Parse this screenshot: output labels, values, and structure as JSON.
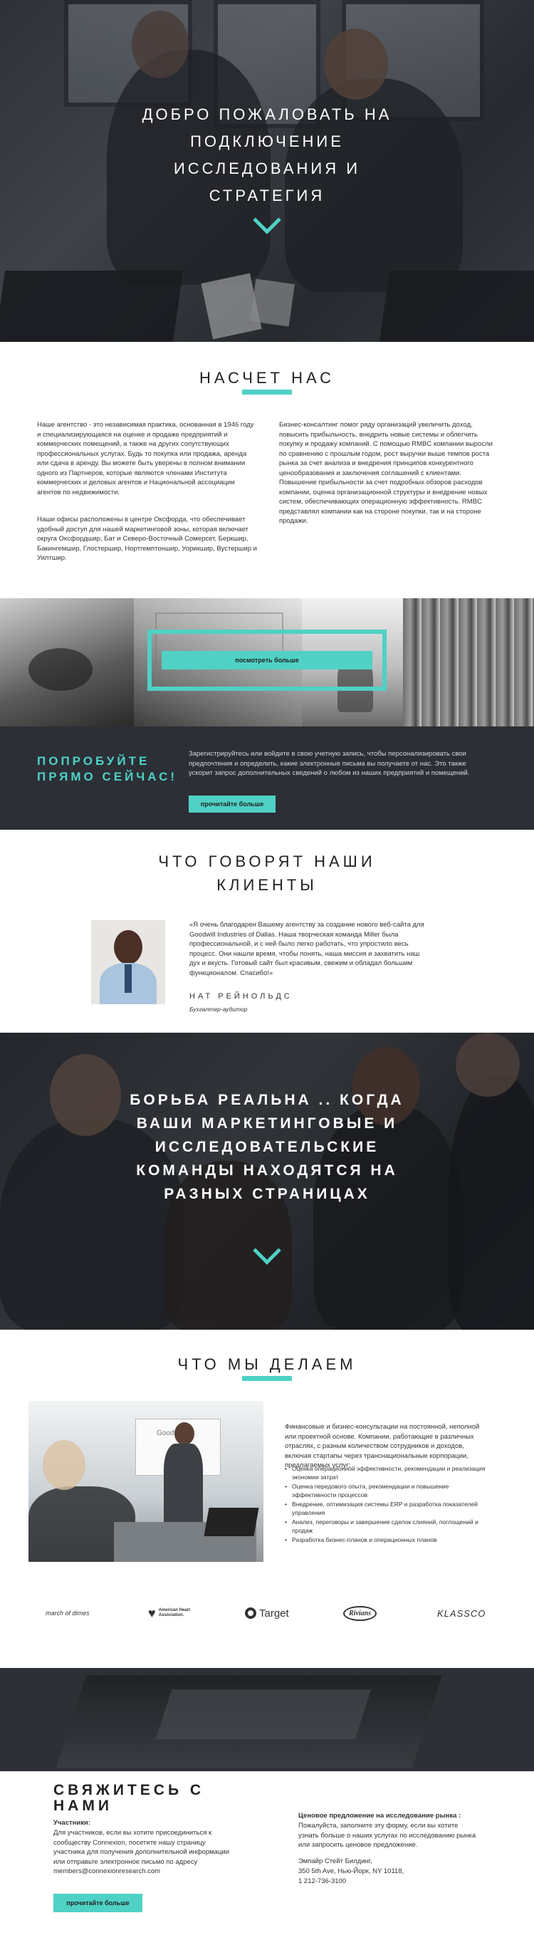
{
  "hero": {
    "title": "ДОБРО ПОЖАЛОВАТЬ НА ПОДКЛЮЧЕНИЕ ИССЛЕДОВАНИЯ И СТРАТЕГИЯ"
  },
  "about": {
    "title": "НАСЧЕТ НАС",
    "left_p1": "Наше агентство - это независимая практика, основанная в 1946 году и специализирующаяся на оценке и продаже предприятий и коммерческих помещений, а также на других сопутствующих профессиональных услугах. Будь то покупка или продажа, аренда или сдача в аренду. Вы можете быть уверены в полном внимании одного из Партнеров, которые являются членами Института коммерческих и деловых агентов и Национальной ассоциации агентов по недвижимости.",
    "left_p2": "Наши офисы расположены в центре Оксфорда, что обеспечивает удобный доступ для нашей маркетинговой зоны, которая включает округа Оксфордшир, Бат и Северо-Восточный Сомерсет, Беркшир, Бакингемшир, Глостершир, Нортгемптоншир, Уорикшир, Вустершир и Уилтшир.",
    "right_p": "Бизнес-консалтинг помог ряду организаций увеличить доход, повысить прибыльность, внедрить новые системы и облегчить покупку и продажу компаний. С помощью RMBC компании выросли по сравнению с прошлым годом, рост выручки выше темпов роста рынка за счет анализа и внедрения принципов конкурентного ценообразования и заключения соглашений с клиентами. Повышение прибыльности за счет подробных обзоров расходов компании, оценка организационной структуры и внедрение новых систем, обеспечивающих операционную эффективность. RMBC представлял компании как на стороне покупки, так и на стороне продажи."
  },
  "gallery": {
    "button_label": "посмотреть больше"
  },
  "try_now": {
    "title": "ПОПРОБУЙТЕ ПРЯМО СЕЙЧАС!",
    "text": "Зарегистрируйтесь или войдите в свою учетную запись, чтобы персонализировать свои предпочтения и определить, какие электронные письма вы получаете от нас. Это также ускорит запрос дополнительных сведений о любом из наших предприятий и помещений.",
    "button_label": "прочитайте больше"
  },
  "testimonial": {
    "title": "ЧТО ГОВОРЯТ НАШИ КЛИЕНТЫ",
    "quote": "«Я очень благодарен Вашему агентству за создание нового веб-сайта для Goodwill Industries of Dallas. Наша творческая команда Miller была профессиональной, и с ней было легко работать, что упростило весь процесс. Они нашли время, чтобы понять, наша миссия и захватить наш дух и вкусть. Готовый сайт был красивым, свежим и обладал большим функционалом. Спасибо!»",
    "name": "НАТ РЕЙНОЛЬДС",
    "role": "Бухгалтер-аудитор"
  },
  "banner2": {
    "title": "БОРЬБА РЕАЛЬНА .. КОГДА ВАШИ МАРКЕТИНГОВЫЕ И ИССЛЕДОВАТЕЛЬСКИЕ КОМАНДЫ НАХОДЯТСЯ НА РАЗНЫХ СТРАНИЦАХ"
  },
  "what_we_do": {
    "title": "ЧТО МЫ ДЕЛАЕМ",
    "intro": "Финансовые и бизнес-консультации на постоянной, неполной или проектной основе. Компании, работающие в различных отраслях, с разным количеством сотрудников и доходов, включая стартапы через транснациональные корпорации, предлагаемых услуг:",
    "items": [
      "Оценка операционной эффективности, рекомендации и реализация экономии затрат",
      "Оценка передового опыта, рекомендации и повышение эффективности процессов",
      "Внедрение, оптимизация системы ERP и разработка показателей управления",
      "Анализ, переговоры и завершение сделок слияний, поглощений и продаж",
      "Разработка бизнес-планов и операционных планов"
    ],
    "board_text": "Goodwill",
    "logos": [
      "march of dimes",
      "American Heart Association.",
      "Target",
      "Rivians",
      "KLASSCO"
    ]
  },
  "contact": {
    "title": "СВЯЖИТЕСЬ С НАМИ",
    "participants_label": "Участники:",
    "participants_text": "Для участников, если вы хотите присоединиться к сообществу Connexion, посетите нашу страницу участника для получения дополнительной информации или отправьте электронное письмо по адресу members@connexionresearch.com",
    "button_label": "прочитайте больше",
    "offer_label": "Ценовое предложение на исследование рынка :",
    "offer_text": "Пожалуйста, заполните эту форму, если вы хотите узнать больше о наших услугах по исследованию рынка или запросить ценовое предложение.",
    "address": [
      "Эмпайр Стейт Билдинг,",
      "350 5th Ave, Нью-Йорк, NY 10118,",
      "1 212-736-3100"
    ]
  },
  "colors": {
    "accent": "#4fd1c5",
    "dark": "#2c2f36"
  }
}
